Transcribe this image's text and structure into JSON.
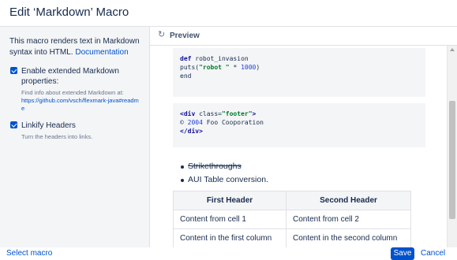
{
  "dialog": {
    "title": "Edit ‘Markdown’ Macro"
  },
  "sidebar": {
    "description": "This macro renders text in Markdown syntax into HTML.",
    "documentation_link": "Documentation",
    "options": [
      {
        "label": "Enable extended Markdown properties:",
        "checked": true,
        "help_text": "Find info about extended Markdown at:",
        "help_link": "https://github.com/vsch/flexmark-java#readme"
      },
      {
        "label": "Linkify Headers",
        "checked": true,
        "help_text": "Turn the headers into links."
      }
    ]
  },
  "preview": {
    "icon": "refresh-icon",
    "title": "Preview",
    "code_block_1": {
      "def": "def",
      "fn": " robot_invasion",
      "line2_a": "puts(",
      "line2_str": "\"robot \"",
      "line2_b": " * ",
      "line2_num": "1000",
      "line2_c": ")",
      "line3": "end"
    },
    "code_block_2": {
      "line1_open": "<div",
      "line1_attr": " class=",
      "line1_str": "\"footer\"",
      "line1_close": ">",
      "line2_copy": "© ",
      "line2_year": "2004",
      "line2_rest": " Foo Cooporation",
      "line3": "</div>"
    },
    "list_items": [
      "Strikethroughs",
      "AUI Table conversion."
    ],
    "table": {
      "headers": [
        "First Header",
        "Second Header"
      ],
      "rows": [
        [
          "Content from cell 1",
          "Content from cell 2"
        ],
        [
          "Content in the first column",
          "Content in the second column"
        ]
      ]
    }
  },
  "footer": {
    "select_macro": "Select macro",
    "save": "Save",
    "cancel": "Cancel"
  },
  "colors": {
    "accent": "#0052cc",
    "sidebar_bg": "#f4f5f7",
    "code_bg": "#f4f5f7"
  }
}
